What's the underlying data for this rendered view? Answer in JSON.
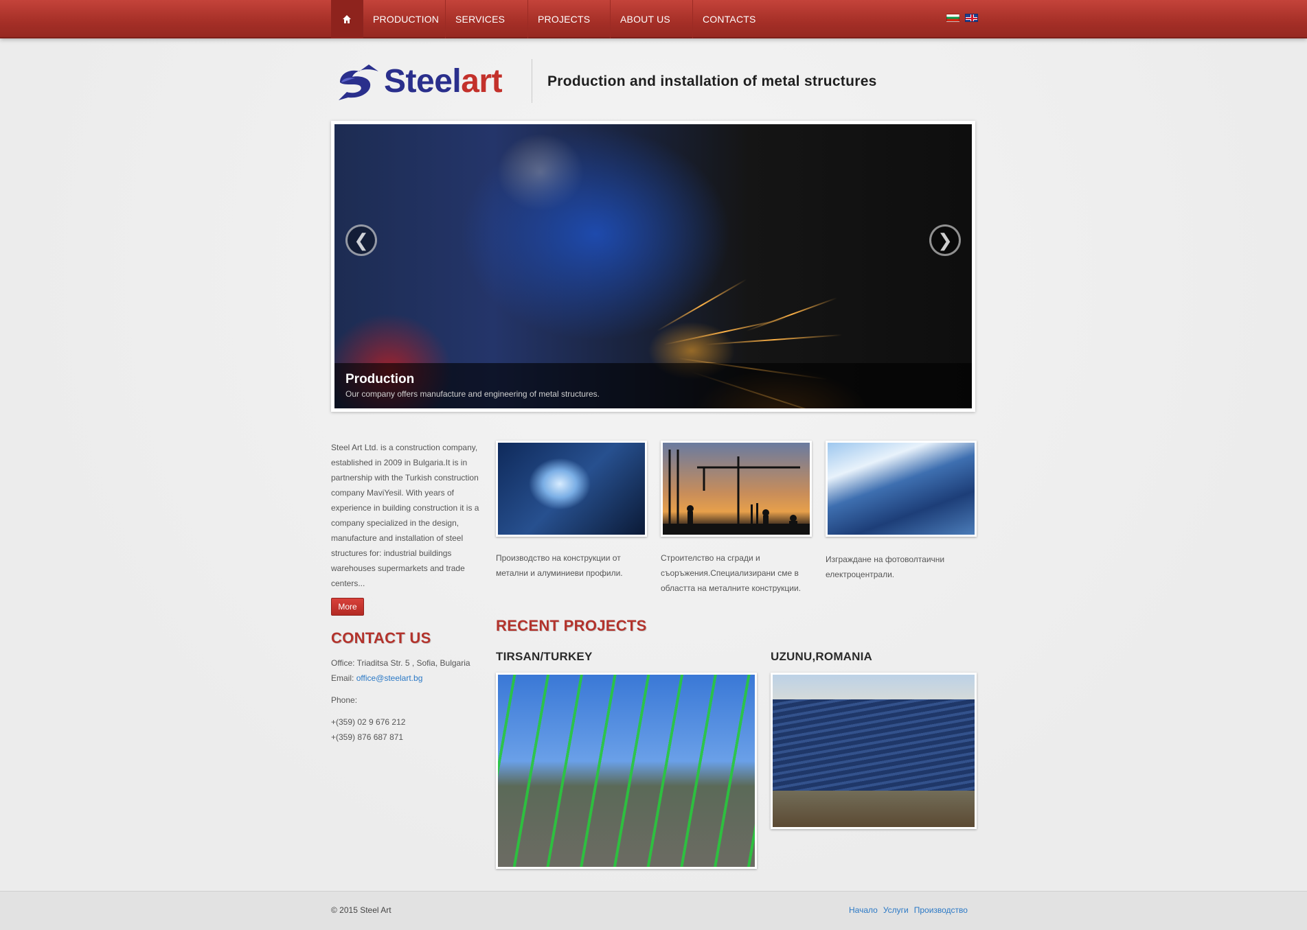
{
  "nav": {
    "home_icon": "home-icon",
    "items": [
      "PRODUCTION",
      "SERVICES",
      "PROJECTS",
      "ABOUT US",
      "CONTACTS"
    ],
    "flags": [
      "bulgarian-flag-icon",
      "english-flag-icon"
    ]
  },
  "header": {
    "logo_steel": "Steel",
    "logo_art": "art",
    "tagline": "Production and installation of metal structures"
  },
  "slider": {
    "title": "Production",
    "description": "Our company offers manufacture and engineering of metal structures.",
    "prev": "❮",
    "next": "❯"
  },
  "intro": {
    "text": "Steel Art Ltd. is a construction company, established in 2009 in Bulgaria.It is in partnership with the Turkish construction company MaviYesil. With years of experience in building construction it is a company specialized in the design, manufacture and installation of steel structures for: industrial buildings warehouses supermarkets and trade centers...",
    "more": "More"
  },
  "contact": {
    "title": "CONTACT US",
    "office": "Office: Triaditsa Str. 5 , Sofia, Bulgaria",
    "email_label": "Email: ",
    "email": "office@steelart.bg",
    "phone_label": "Phone:",
    "phone1": "+(359) 02 9 676 212",
    "phone2": "+(359) 876 687 871"
  },
  "features": [
    {
      "text": "Производство на конструкции от метални и алуминиеви профили."
    },
    {
      "text": "Строителство на сгради и съоръжения.Специализирани сме в областта на металните конструкции."
    },
    {
      "text": "Изграждане на фотоволтаични електроцентрали."
    }
  ],
  "projects": {
    "title": "RECENT PROJECTS",
    "items": [
      {
        "name": "TIRSAN/TURKEY"
      },
      {
        "name": "UZUNU,ROMANIA"
      }
    ]
  },
  "footer": {
    "copyright": "© 2015 Steel Art",
    "links": [
      "Начало",
      "Услуги",
      "Производство"
    ]
  },
  "colors": {
    "accent": "#b3332c",
    "nav_bg": "#a52f27",
    "logo_blue": "#2a2f8c",
    "link": "#2a78c5"
  }
}
